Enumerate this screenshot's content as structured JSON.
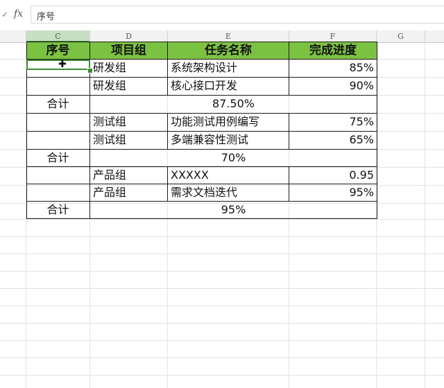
{
  "formula_bar": {
    "check_icon": "check-icon",
    "fx_label": "fx",
    "value": "序号"
  },
  "columns": {
    "c": "C",
    "d": "D",
    "e": "E",
    "f": "F",
    "g": "G"
  },
  "table": {
    "headers": [
      "序号",
      "项目组",
      "任务名称",
      "完成进度"
    ],
    "rows": [
      {
        "no": "",
        "group": "研发组",
        "task": "系统架构设计",
        "progress": "85%"
      },
      {
        "no": "",
        "group": "研发组",
        "task": "核心接口开发",
        "progress": "90%"
      },
      {
        "total_label": "合计",
        "total_value": "87.50%"
      },
      {
        "no": "",
        "group": "测试组",
        "task": "功能测试用例编写",
        "progress": "75%"
      },
      {
        "no": "",
        "group": "测试组",
        "task": "多端兼容性测试",
        "progress": "65%"
      },
      {
        "total_label": "合计",
        "total_value": "70%"
      },
      {
        "no": "",
        "group": "产品组",
        "task": "XXXXX",
        "progress": "0.95"
      },
      {
        "no": "",
        "group": "产品组",
        "task": "需求文档迭代",
        "progress": "95%"
      },
      {
        "total_label": "合计",
        "total_value": "95%"
      }
    ]
  },
  "colors": {
    "header_green": "#7cc242",
    "selection_green": "#3c8b33"
  }
}
